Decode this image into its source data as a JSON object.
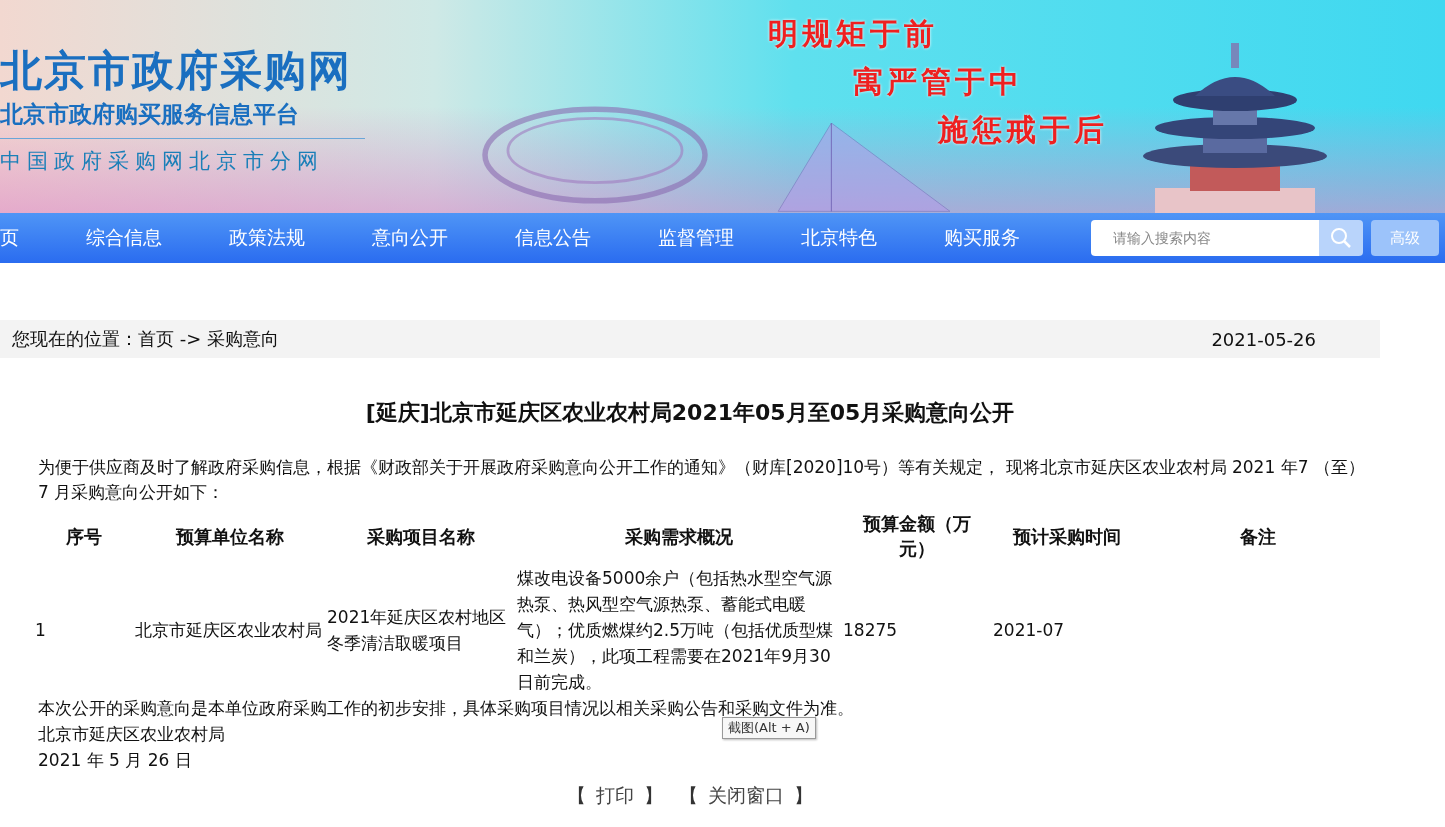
{
  "banner": {
    "logo_title": "北京市政府采购网",
    "logo_subtitle": "北京市政府购买服务信息平台",
    "logo_tagline": "中国政府采购网北京市分网",
    "slogans": [
      "明规矩于前",
      "寓严管于中",
      "施惩戒于后"
    ]
  },
  "nav": {
    "items": [
      "页",
      "综合信息",
      "政策法规",
      "意向公开",
      "信息公告",
      "监督管理",
      "北京特色",
      "购买服务"
    ],
    "search": {
      "placeholder": "请输入搜索内容"
    },
    "advanced_button": "高级"
  },
  "breadcrumb": {
    "label": "您现在的位置：",
    "path": "首页 -> 采购意向",
    "date": "2021-05-26"
  },
  "article": {
    "title": "[延庆]北京市延庆区农业农村局2021年05月至05月采购意向公开",
    "intro": "为便于供应商及时了解政府采购信息，根据《财政部关于开展政府采购意向公开工作的通知》（财库[2020]10号）等有关规定， 现将北京市延庆区农业农村局 2021 年7 （至）7 月采购意向公开如下：",
    "table": {
      "columns": [
        "序号",
        "预算单位名称",
        "采购项目名称",
        "采购需求概况",
        "预算金额（万元）",
        "预计采购时间",
        "备注"
      ],
      "rows": [
        [
          "1",
          "北京市延庆区农业农村局",
          "2021年延庆区农村地区冬季清洁取暖项目",
          "煤改电设备5000余户（包括热水型空气源热泵、热风型空气源热泵、蓄能式电暖气）；优质燃煤约2.5万吨（包括优质型煤和兰炭），此项工程需要在2021年9月30日前完成。",
          "18275",
          "2021-07",
          ""
        ]
      ]
    },
    "note": "本次公开的采购意向是本单位政府采购工作的初步安排，具体采购项目情况以相关采购公告和采购文件为准。",
    "signature": "北京市延庆区农业农村局",
    "date": "2021 年 5 月 26 日"
  },
  "tooltip": "截图(Alt + A)",
  "actions": [
    {
      "open": "【",
      "label": "打印",
      "close": "】"
    },
    {
      "open": "【",
      "label": "关闭窗口",
      "close": "】"
    }
  ]
}
